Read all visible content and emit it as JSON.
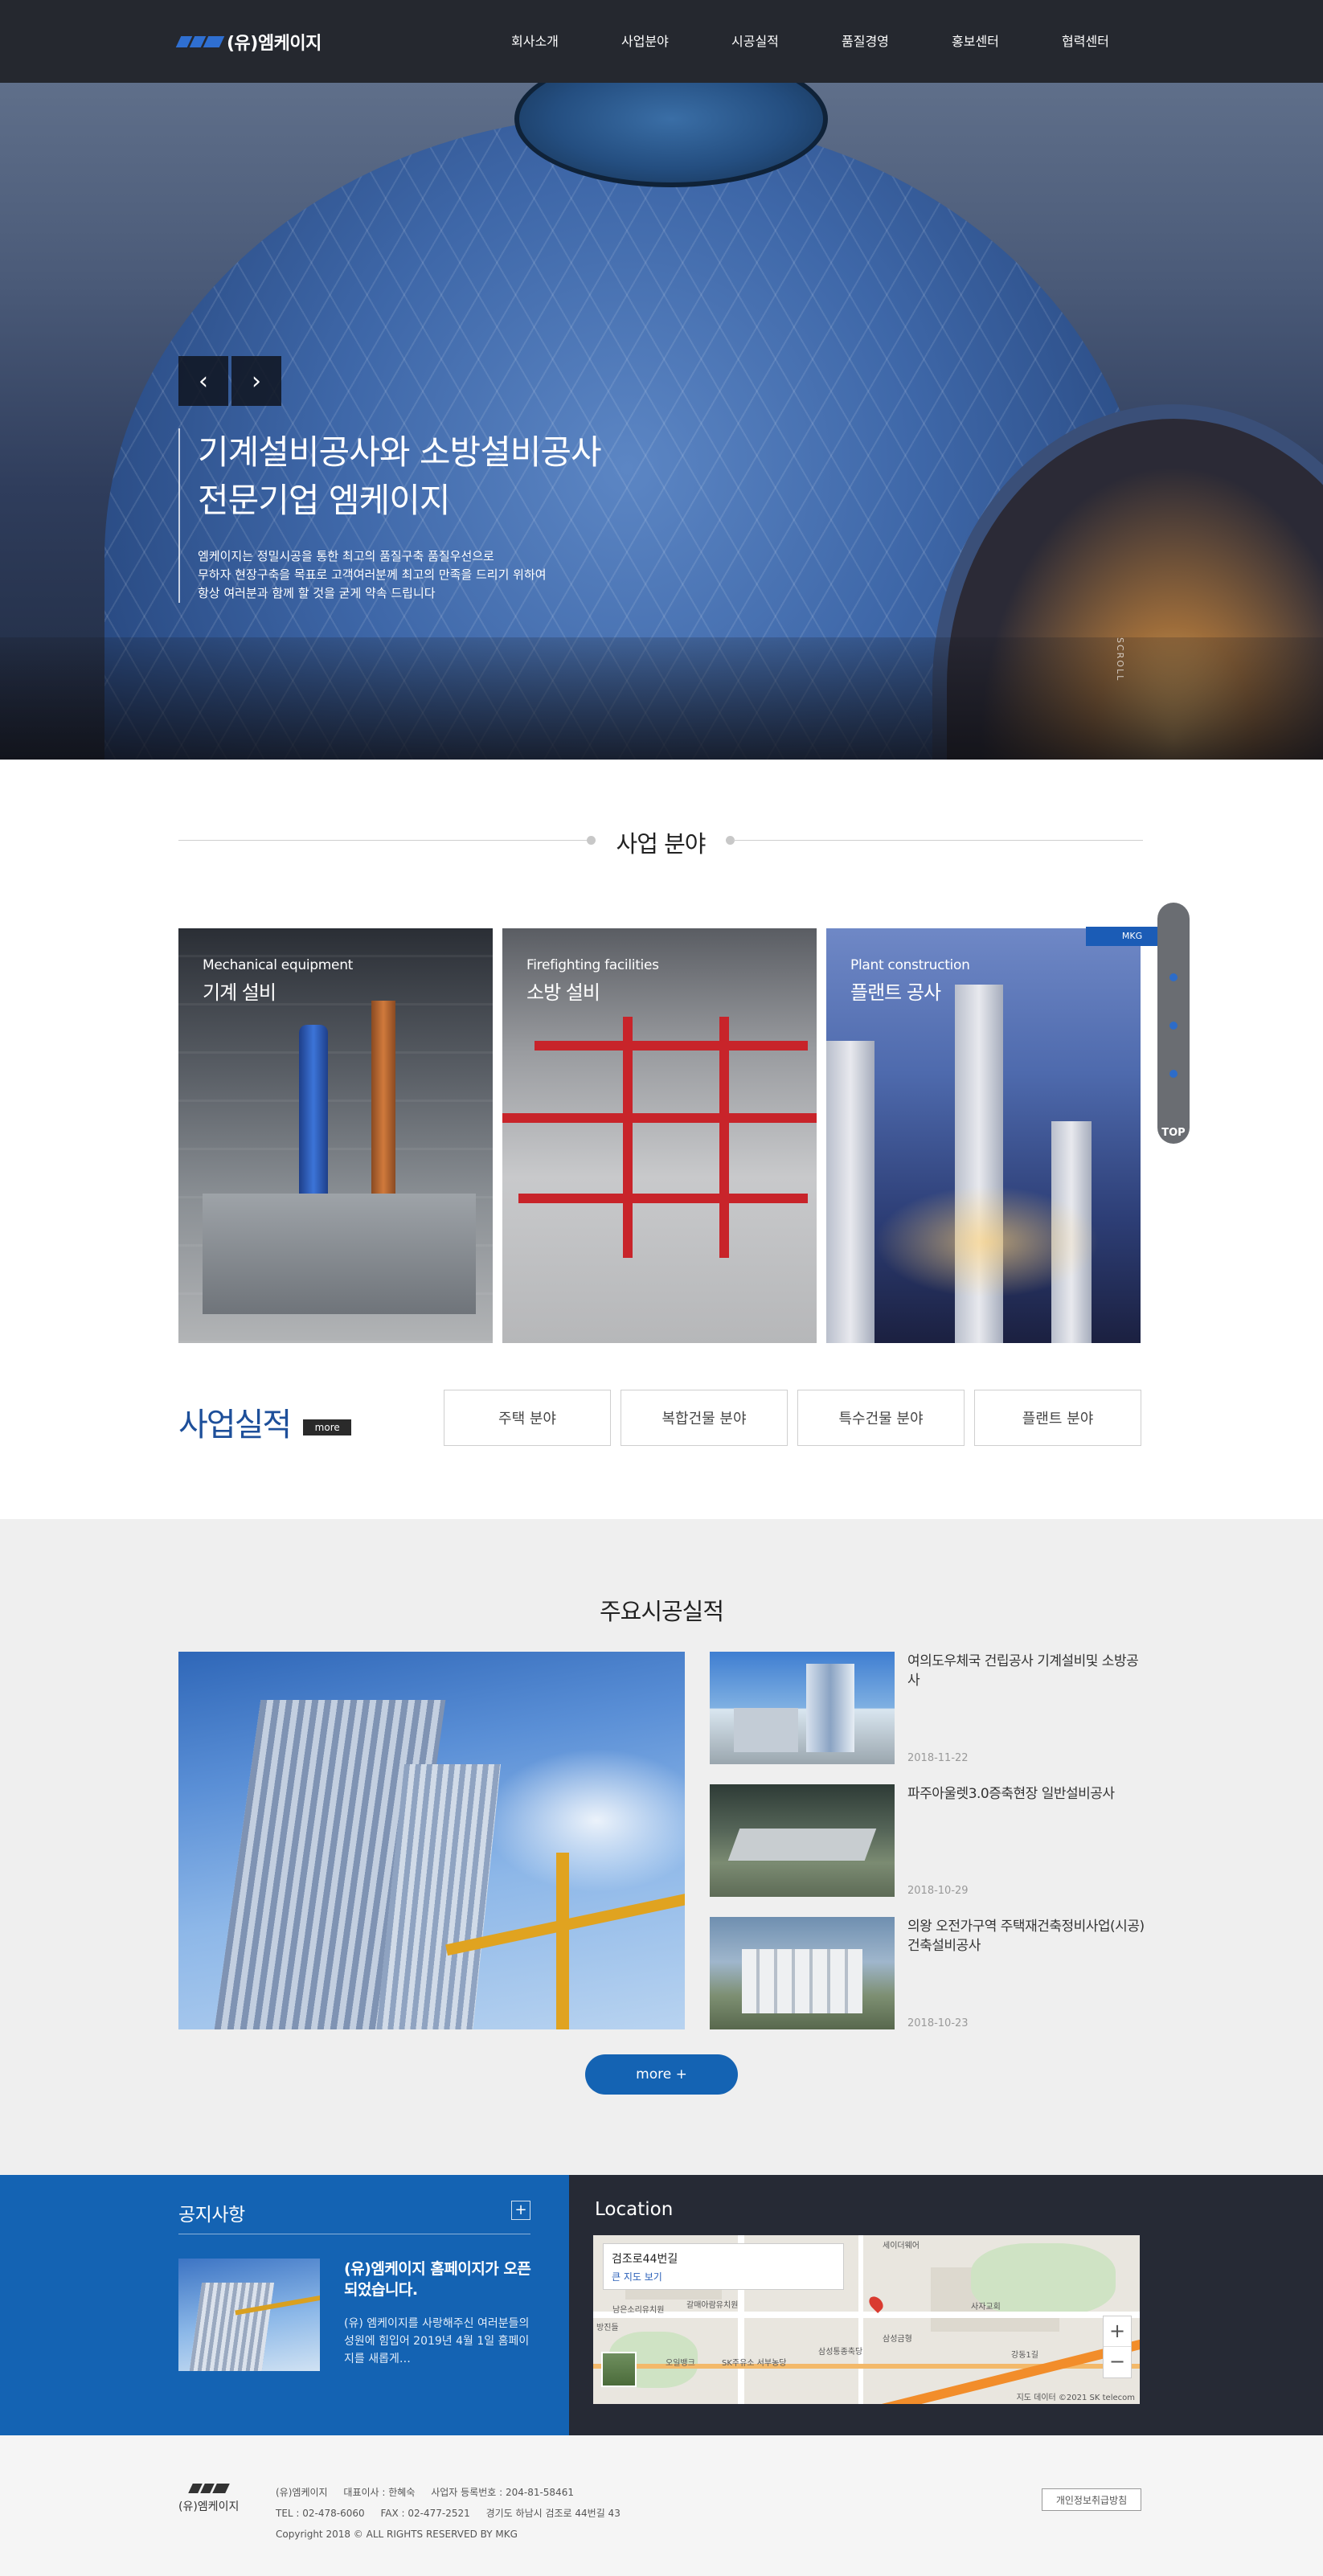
{
  "header": {
    "logo_text": "(유)엠케이지",
    "nav": [
      "회사소개",
      "사업분야",
      "시공실적",
      "품질경영",
      "홍보센터",
      "협력센터"
    ]
  },
  "hero": {
    "prev_icon": "‹",
    "next_icon": "›",
    "title_line1": "기계설비공사와 소방설비공사",
    "title_line2": "전문기업 엠케이지",
    "desc_line1": "엠케이지는 정밀시공을 통한 최고의 품질구축 품질우선으로",
    "desc_line2": "무하자 현장구축을 목표로 고객여러분께 최고의 만족을 드리기 위하여",
    "desc_line3": "항상 여러분과 함께 할 것을 굳게 약속 드립니다",
    "scroll_label": "SCROLL"
  },
  "business": {
    "title": "사업 분야",
    "badge": "MKG",
    "cards": [
      {
        "en": "Mechanical equipment",
        "ko": "기계 설비"
      },
      {
        "en": "Firefighting facilities",
        "ko": "소방 설비"
      },
      {
        "en": "Plant construction",
        "ko": "플랜트 공사"
      }
    ]
  },
  "side_nav": {
    "top_label": "TOP"
  },
  "performance": {
    "title_a": "사업",
    "title_b": "실적",
    "more_label": "more",
    "tabs": [
      "주택 분야",
      "복합건물 분야",
      "특수건물 분야",
      "플랜트 분야"
    ]
  },
  "works": {
    "title": "주요시공실적",
    "items": [
      {
        "title": "여의도우체국 건립공사 기계설비및 소방공사",
        "date": "2018-11-22"
      },
      {
        "title": "파주아울렛3.0증축현장 일반설비공사",
        "date": "2018-10-29"
      },
      {
        "title": "의왕 오전가구역 주택재건축정비사업(시공) 건축설비공사",
        "date": "2018-10-23"
      }
    ],
    "more_label": "more +"
  },
  "notice": {
    "title": "공지사항",
    "plus_label": "+",
    "item_title": "(유)엠케이지 홈페이지가 오픈되었습니다.",
    "item_desc": "(유) 엠케이지를 사랑해주신 여러분들의 성원에 힘입어 2019년 4월 1일 홈페이지를 새롭게…"
  },
  "location": {
    "title": "Location",
    "map_address": "검조로44번길",
    "map_big_link": "큰 지도 보기",
    "zoom_in": "+",
    "zoom_out": "−",
    "copyright": "지도 데이터 ©2021 SK telecom",
    "labels": [
      "세이더웨어",
      "방진들",
      "남은소리유치원",
      "갈매아람유치원",
      "삼성통종축당",
      "사자교회",
      "SK주유소 서부농당",
      "오일뱅크",
      "강동1길",
      "삼성금형"
    ]
  },
  "footer": {
    "logo_name": "(유)엠케이지",
    "company": "(유)엠케이지",
    "ceo": "대표이사 : 한혜숙",
    "biz_no": "사업자 등록번호 : 204-81-58461",
    "tel": "TEL : 02-478-6060",
    "fax": "FAX : 02-477-2521",
    "address": "경기도 하남시 검조로 44번길 43",
    "copyright": "Copyright 2018 © ALL RIGHTS RESERVED BY MKG",
    "privacy_label": "개인정보취급방침"
  },
  "colors": {
    "primary": "#1463b3",
    "dark": "#262a35",
    "accent": "#1d4f9a"
  }
}
